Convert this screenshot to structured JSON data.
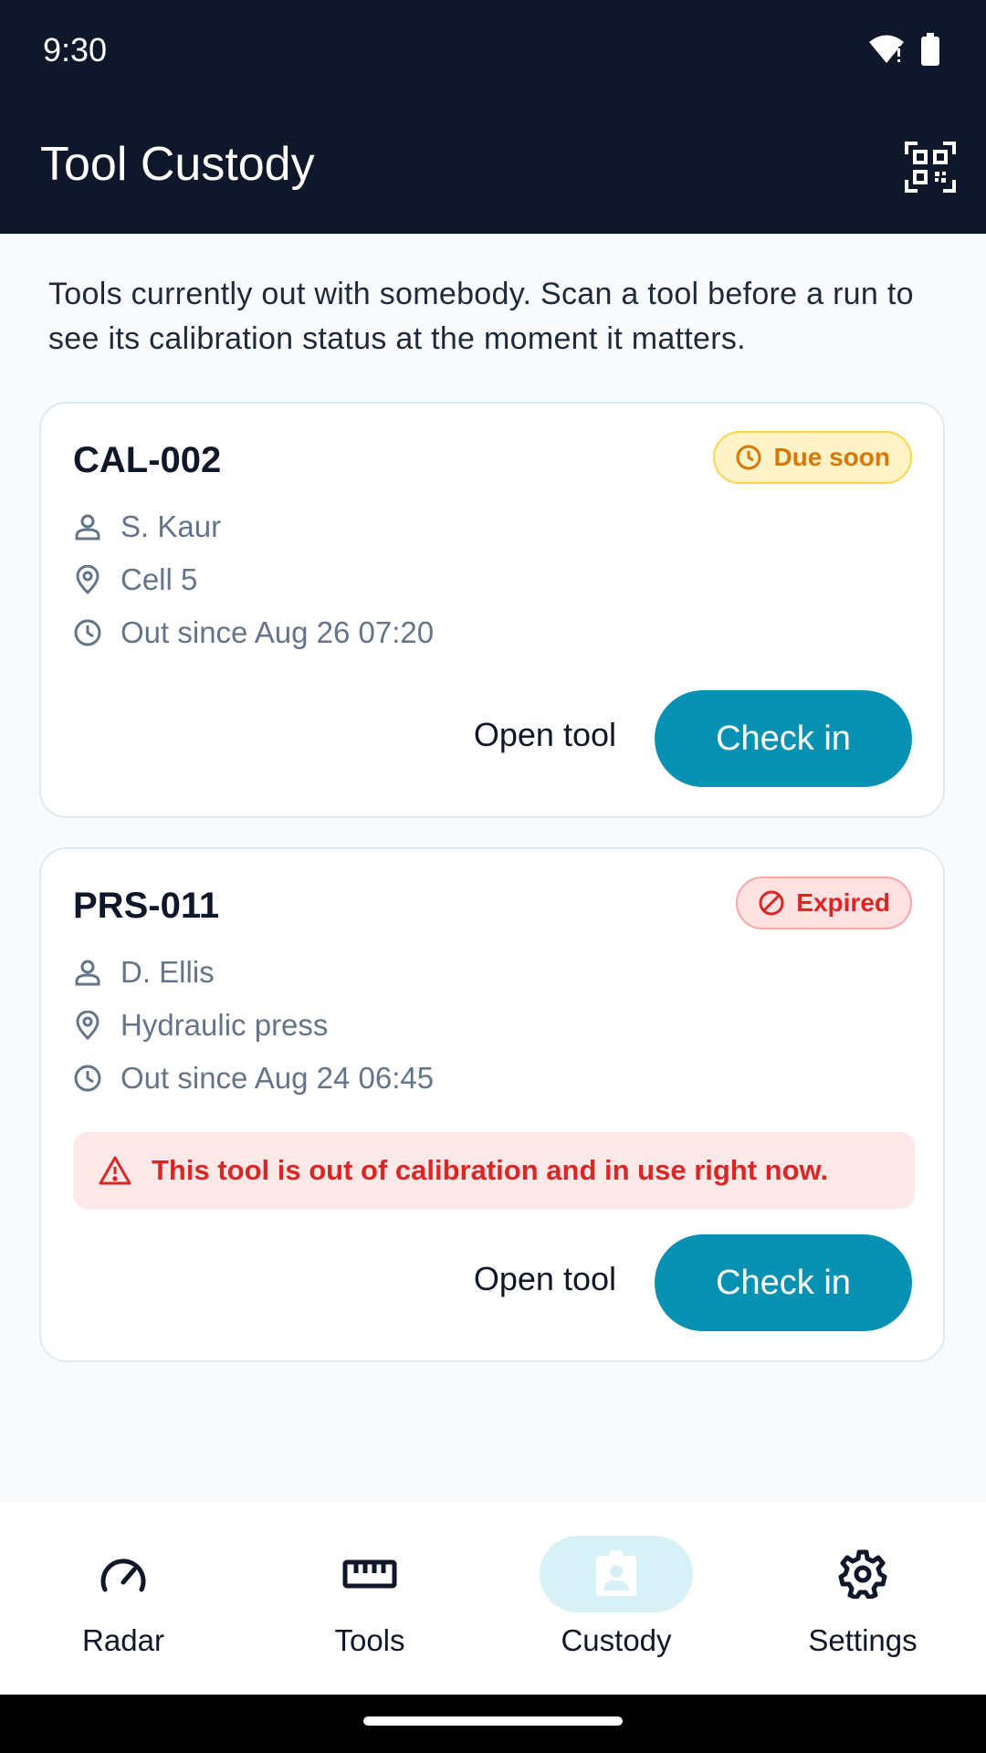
{
  "status_bar": {
    "time": "9:30"
  },
  "app_bar": {
    "title": "Tool Custody",
    "scan_icon": "qr-scan-icon"
  },
  "intro": "Tools currently out with somebody. Scan a tool before a run to see its calibration status at the moment it matters.",
  "cards": [
    {
      "tool_id": "CAL-002",
      "badge": {
        "label": "Due soon",
        "icon": "clock-icon",
        "color": "#d97706"
      },
      "person": "S. Kaur",
      "location": "Cell 5",
      "out_since": "Out since Aug 26 07:20",
      "open_label": "Open tool",
      "checkin_label": "Check in"
    },
    {
      "tool_id": "PRS-011",
      "badge": {
        "label": "Expired",
        "icon": "ban-icon",
        "color": "#dc2626"
      },
      "person": "D. Ellis",
      "location": "Hydraulic press",
      "out_since": "Out since Aug 24 06:45",
      "alert": "This tool is out of calibration and in use right now.",
      "open_label": "Open tool",
      "checkin_label": "Check in"
    }
  ],
  "nav": [
    {
      "label": "Radar",
      "icon": "gauge-icon",
      "active": false
    },
    {
      "label": "Tools",
      "icon": "ruler-icon",
      "active": false
    },
    {
      "label": "Custody",
      "icon": "badge-icon",
      "active": true
    },
    {
      "label": "Settings",
      "icon": "gear-icon",
      "active": false
    }
  ],
  "colors": {
    "header": "#0f172a",
    "accent": "#0891b2",
    "background": "#f8fafc"
  }
}
